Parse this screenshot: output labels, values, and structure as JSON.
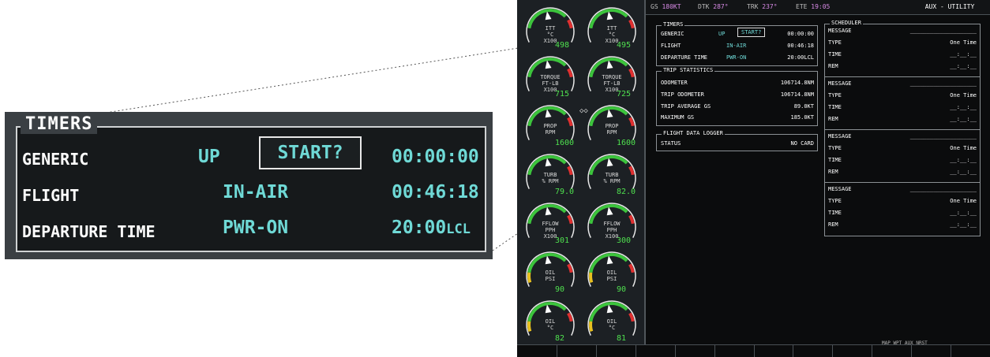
{
  "zoom": {
    "title": "TIMERS",
    "rows": [
      {
        "label": "GENERIC",
        "mode": "UP",
        "button": "START?",
        "value": "00:00:00"
      },
      {
        "label": "FLIGHT",
        "mode": "IN-AIR",
        "value": "00:46:18"
      },
      {
        "label": "DEPARTURE TIME",
        "mode": "PWR-ON",
        "value": "20:00",
        "unit": "LCL"
      }
    ]
  },
  "topbar": {
    "gs_label": "GS",
    "gs_value": "180KT",
    "dtk_label": "DTK",
    "dtk_value": "287°",
    "trk_label": "TRK",
    "trk_value": "237°",
    "ete_label": "ETE",
    "ete_value": "19:05",
    "page": "AUX - UTILITY"
  },
  "timers": {
    "title": "TIMERS",
    "generic_label": "GENERIC",
    "generic_mode": "UP",
    "generic_button": "START?",
    "generic_value": "00:00:00",
    "flight_label": "FLIGHT",
    "flight_mode": "IN-AIR",
    "flight_value": "00:46:18",
    "dep_label": "DEPARTURE TIME",
    "dep_mode": "PWR-ON",
    "dep_value": "20:00LCL"
  },
  "trip": {
    "title": "TRIP STATISTICS",
    "rows": [
      {
        "label": "ODOMETER",
        "value": "106714.8NM"
      },
      {
        "label": "TRIP ODOMETER",
        "value": "106714.8NM"
      },
      {
        "label": "TRIP AVERAGE GS",
        "value": "89.0KT"
      },
      {
        "label": "MAXIMUM GS",
        "value": "185.0KT"
      }
    ]
  },
  "logger": {
    "title": "FLIGHT DATA LOGGER",
    "status_label": "STATUS",
    "status_value": "NO CARD"
  },
  "scheduler": {
    "title": "SCHEDULER",
    "blocks": [
      {
        "message_label": "MESSAGE",
        "message_value": "____________________",
        "type_label": "TYPE",
        "type_value": "One Time",
        "time_label": "TIME",
        "time_value": "__:__:__",
        "rem_label": "REM",
        "rem_value": "__:__:__"
      },
      {
        "message_label": "MESSAGE",
        "message_value": "____________________",
        "type_label": "TYPE",
        "type_value": "One Time",
        "time_label": "TIME",
        "time_value": "__:__:__",
        "rem_label": "REM",
        "rem_value": "__:__:__"
      },
      {
        "message_label": "MESSAGE",
        "message_value": "____________________",
        "type_label": "TYPE",
        "type_value": "One Time",
        "time_label": "TIME",
        "time_value": "__:__:__",
        "rem_label": "REM",
        "rem_value": "__:__:__"
      },
      {
        "message_label": "MESSAGE",
        "message_value": "____________________",
        "type_label": "TYPE",
        "type_value": "One Time",
        "time_label": "TIME",
        "time_value": "__:__:__",
        "rem_label": "REM",
        "rem_value": "__:__:__"
      }
    ]
  },
  "gauges": [
    {
      "name": "itt-left",
      "l1": "ITT",
      "l2": "°C",
      "l3": "X100",
      "value": "498"
    },
    {
      "name": "itt-right",
      "l1": "ITT",
      "l2": "°C",
      "l3": "X100",
      "value": "495"
    },
    {
      "name": "torque-left",
      "l1": "TORQUE",
      "l2": "FT-LB",
      "l3": "X100",
      "value": "715"
    },
    {
      "name": "torque-right",
      "l1": "TORQUE",
      "l2": "FT-LB",
      "l3": "X100",
      "value": "725"
    },
    {
      "name": "prop-left",
      "l1": "PROP",
      "l2": "RPM",
      "l3": "",
      "value": "1600"
    },
    {
      "name": "prop-right",
      "l1": "PROP",
      "l2": "RPM",
      "l3": "",
      "value": "1600"
    },
    {
      "name": "turb-left",
      "l1": "TURB",
      "l2": "% RPM",
      "l3": "",
      "value": "79.0"
    },
    {
      "name": "turb-right",
      "l1": "TURB",
      "l2": "% RPM",
      "l3": "",
      "value": "82.0"
    },
    {
      "name": "fflow-left",
      "l1": "FFLOW",
      "l2": "PPH",
      "l3": "X100",
      "value": "301"
    },
    {
      "name": "fflow-right",
      "l1": "FFLOW",
      "l2": "PPH",
      "l3": "X100",
      "value": "300"
    },
    {
      "name": "oilpsi-left",
      "l1": "OIL",
      "l2": "PSI",
      "l3": "",
      "value": "90"
    },
    {
      "name": "oilpsi-right",
      "l1": "OIL",
      "l2": "PSI",
      "l3": "",
      "value": "90"
    },
    {
      "name": "oiltemp-left",
      "l1": "OIL",
      "l2": "°C",
      "l3": "",
      "value": "82"
    },
    {
      "name": "oiltemp-right",
      "l1": "OIL",
      "l2": "°C",
      "l3": "",
      "value": "81"
    }
  ],
  "softkey_row": {
    "label": "MAP WPT AUX NRST"
  },
  "colors": {
    "cyan": "#6fd9d6",
    "magenta": "#d88ae6",
    "green": "#4fe04f",
    "background": "#0b0c0d"
  }
}
